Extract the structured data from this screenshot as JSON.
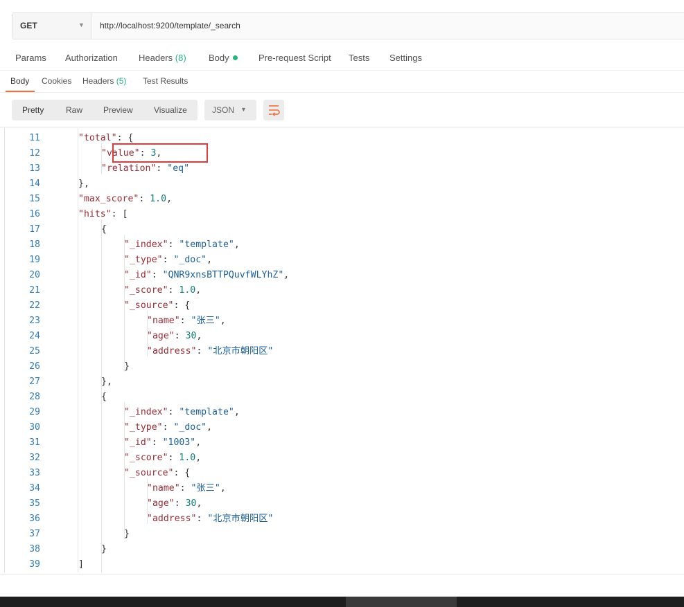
{
  "request": {
    "method": "GET",
    "url": "http://localhost:9200/template/_search"
  },
  "request_tabs": [
    {
      "label": "Params"
    },
    {
      "label": "Authorization"
    },
    {
      "label": "Headers",
      "count": "(8)"
    },
    {
      "label": "Body"
    },
    {
      "label": "Pre-request Script"
    },
    {
      "label": "Tests"
    },
    {
      "label": "Settings"
    }
  ],
  "response_tabs": [
    {
      "label": "Body"
    },
    {
      "label": "Cookies"
    },
    {
      "label": "Headers",
      "count": "(5)"
    },
    {
      "label": "Test Results"
    }
  ],
  "view_modes": [
    "Pretty",
    "Raw",
    "Preview",
    "Visualize"
  ],
  "format": "JSON",
  "icons": {
    "method_dropdown": "chevron-down-icon",
    "format_dropdown": "chevron-down-icon",
    "wrap": "wrap-lines-icon",
    "body_indicator": "dot-icon"
  },
  "colors": {
    "accent": "#f26b3a",
    "count_green": "#26b47f",
    "highlight_box": "#e03a3a"
  },
  "code_lines": [
    {
      "num": "11",
      "text": "\"total\": {"
    },
    {
      "num": "12",
      "text": "\"value\": 3,"
    },
    {
      "num": "13",
      "text": "\"relation\": \"eq\""
    },
    {
      "num": "14",
      "text": "},"
    },
    {
      "num": "15",
      "text": "\"max_score\": 1.0,"
    },
    {
      "num": "16",
      "text": "\"hits\": ["
    },
    {
      "num": "17",
      "text": "{"
    },
    {
      "num": "18",
      "text": "\"_index\": \"template\","
    },
    {
      "num": "19",
      "text": "\"_type\": \"_doc\","
    },
    {
      "num": "20",
      "text": "\"_id\": \"QNR9xnsBTTPQuvfWLYhZ\","
    },
    {
      "num": "21",
      "text": "\"_score\": 1.0,"
    },
    {
      "num": "22",
      "text": "\"_source\": {"
    },
    {
      "num": "23",
      "text": "\"name\": \"张三\","
    },
    {
      "num": "24",
      "text": "\"age\": 30,"
    },
    {
      "num": "25",
      "text": "\"address\": \"北京市朝阳区\""
    },
    {
      "num": "26",
      "text": "}"
    },
    {
      "num": "27",
      "text": "},"
    },
    {
      "num": "28",
      "text": "{"
    },
    {
      "num": "29",
      "text": "\"_index\": \"template\","
    },
    {
      "num": "30",
      "text": "\"_type\": \"_doc\","
    },
    {
      "num": "31",
      "text": "\"_id\": \"1003\","
    },
    {
      "num": "32",
      "text": "\"_score\": 1.0,"
    },
    {
      "num": "33",
      "text": "\"_source\": {"
    },
    {
      "num": "34",
      "text": "\"name\": \"张三\","
    },
    {
      "num": "35",
      "text": "\"age\": 30,"
    },
    {
      "num": "36",
      "text": "\"address\": \"北京市朝阳区\""
    },
    {
      "num": "37",
      "text": "}"
    },
    {
      "num": "38",
      "text": "}"
    },
    {
      "num": "39",
      "text": "]"
    }
  ]
}
